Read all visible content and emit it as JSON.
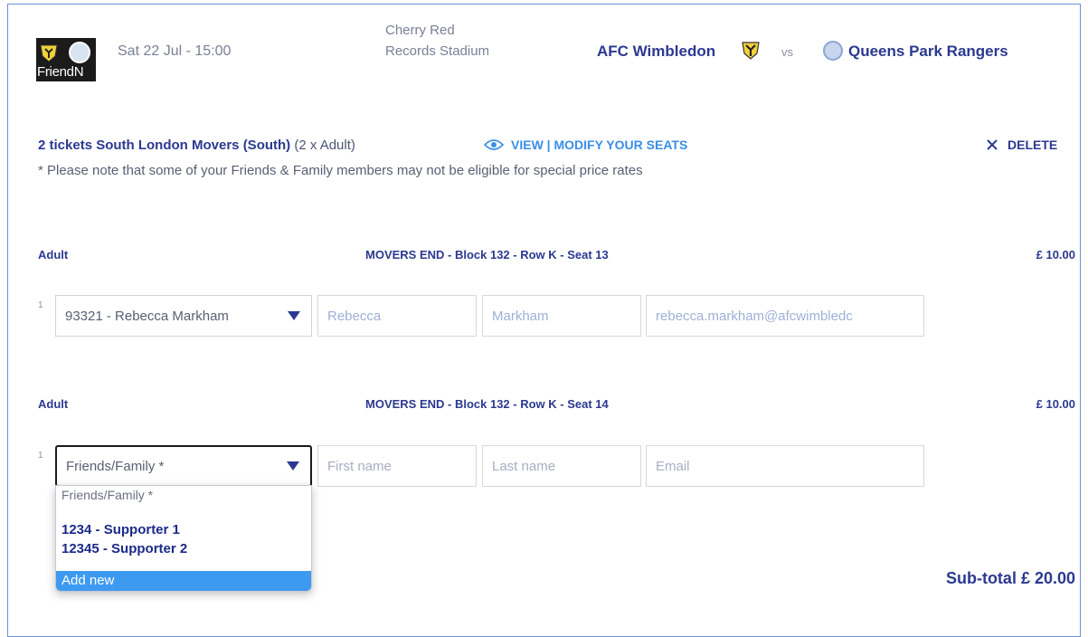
{
  "header": {
    "logo_text": "FriendN",
    "date": "Sat 22 Jul - 15:00",
    "venue": "Cherry Red Records Stadium",
    "home_team": "AFC Wimbledon",
    "vs": "vs",
    "away_team": "Queens Park Rangers"
  },
  "ticket_summary": {
    "title": "2 tickets South London Movers (South)",
    "quantity": "(2 x Adult)",
    "view_link": "VIEW | MODIFY YOUR SEATS",
    "delete": "DELETE",
    "note": "* Please note that some of your Friends & Family members may not be eligible for special price rates"
  },
  "seats": [
    {
      "type": "Adult",
      "desc": "MOVERS END - Block 132 - Row K - Seat 13",
      "price": "£ 10.00",
      "index": "1",
      "select_value": "93321 - Rebecca Markham",
      "first_name": "Rebecca",
      "last_name": "Markham",
      "email": "rebecca.markham@afcwimbledc"
    },
    {
      "type": "Adult",
      "desc": "MOVERS END - Block 132 - Row K - Seat 14",
      "price": "£ 10.00",
      "index": "1",
      "select_value": "Friends/Family *",
      "first_name_placeholder": "First name",
      "last_name_placeholder": "Last name",
      "email_placeholder": "Email"
    }
  ],
  "dropdown": {
    "header": "Friends/Family *",
    "options": [
      "1234 - Supporter 1",
      "12345 - Supporter 2"
    ],
    "add_new": "Add new"
  },
  "subtotal": "Sub-total £ 20.00",
  "colors": {
    "brand_navy": "#2b3990",
    "link_blue": "#3a8ee6",
    "highlight": "#3d9af0"
  }
}
